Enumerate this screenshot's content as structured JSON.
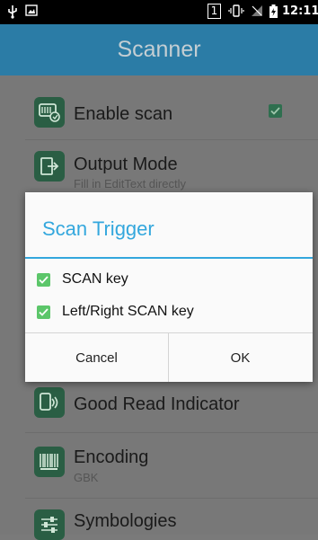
{
  "status_bar": {
    "usb_icon": "usb-icon",
    "image_icon": "gallery-icon",
    "sim_slot": "1",
    "vibrate_icon": "vibrate-icon",
    "no_signal_icon": "no-signal-icon",
    "battery_icon": "battery-charging-icon",
    "time": "12:11"
  },
  "app_bar": {
    "title": "Scanner"
  },
  "settings": [
    {
      "icon": "scan-icon",
      "title": "Enable scan",
      "checked": true
    },
    {
      "icon": "output-icon",
      "title": "Output Mode",
      "subtitle": "Fill in EditText directly"
    },
    {
      "icon": "indicator-icon",
      "title": "Good Read Indicator"
    },
    {
      "icon": "barcode-icon",
      "title": "Encoding",
      "subtitle": "GBK"
    },
    {
      "icon": "sliders-icon",
      "title": "Symbologies"
    }
  ],
  "dialog": {
    "title": "Scan Trigger",
    "options": [
      {
        "label": "SCAN key",
        "checked": true
      },
      {
        "label": "Left/Right SCAN key",
        "checked": true
      }
    ],
    "cancel": "Cancel",
    "ok": "OK"
  },
  "colors": {
    "app_bar": "#2b7ca6",
    "accent": "#33a7dd",
    "checkbox": "#5cc66a"
  }
}
